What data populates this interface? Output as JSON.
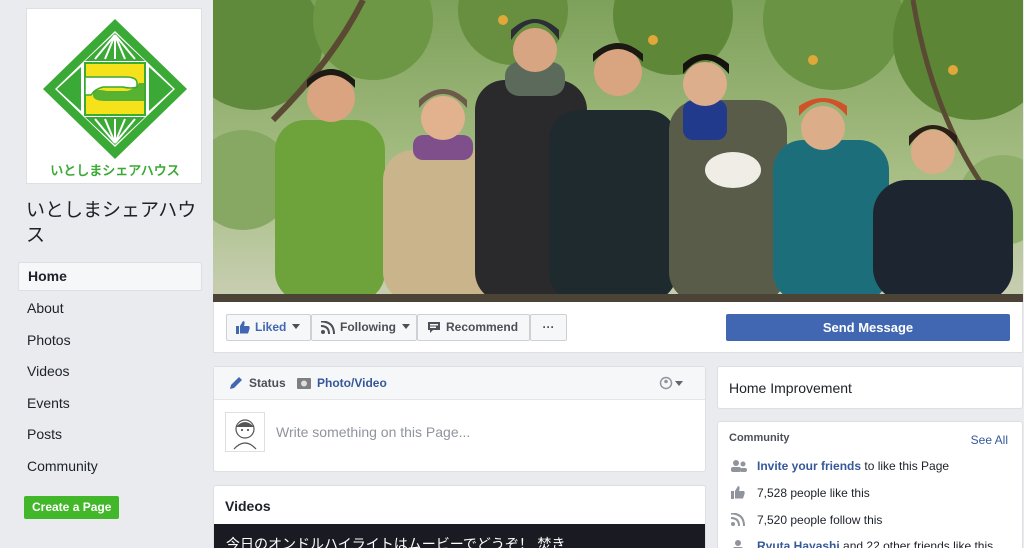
{
  "page": {
    "name": "いとしまシェアハウス",
    "logo_text": "いとしまシェアハウス",
    "brand_green": "#3aa935",
    "brand_yellow": "#f5e21a"
  },
  "nav": {
    "items": [
      {
        "label": "Home",
        "active": true
      },
      {
        "label": "About"
      },
      {
        "label": "Photos"
      },
      {
        "label": "Videos"
      },
      {
        "label": "Events"
      },
      {
        "label": "Posts"
      },
      {
        "label": "Community"
      }
    ],
    "create_page": "Create a Page"
  },
  "actions": {
    "liked": "Liked",
    "following": "Following",
    "recommend": "Recommend",
    "more": "···",
    "send_message": "Send Message"
  },
  "composer": {
    "status": "Status",
    "photo_video": "Photo/Video",
    "placeholder": "Write something on this Page..."
  },
  "videos": {
    "title": "Videos",
    "caption": "今日のオンドルハイライトはムービーでどうぞ！ 焚き"
  },
  "sidebar": {
    "category": "Home Improvement",
    "community": {
      "title": "Community",
      "see_all": "See All",
      "invite_link": "Invite your friends",
      "invite_rest": " to like this Page",
      "likes": "7,528 people like this",
      "follows": "7,520 people follow this",
      "friend_name": "Ryuta Hayashi",
      "friend_rest": " and 22 other friends like this"
    }
  }
}
